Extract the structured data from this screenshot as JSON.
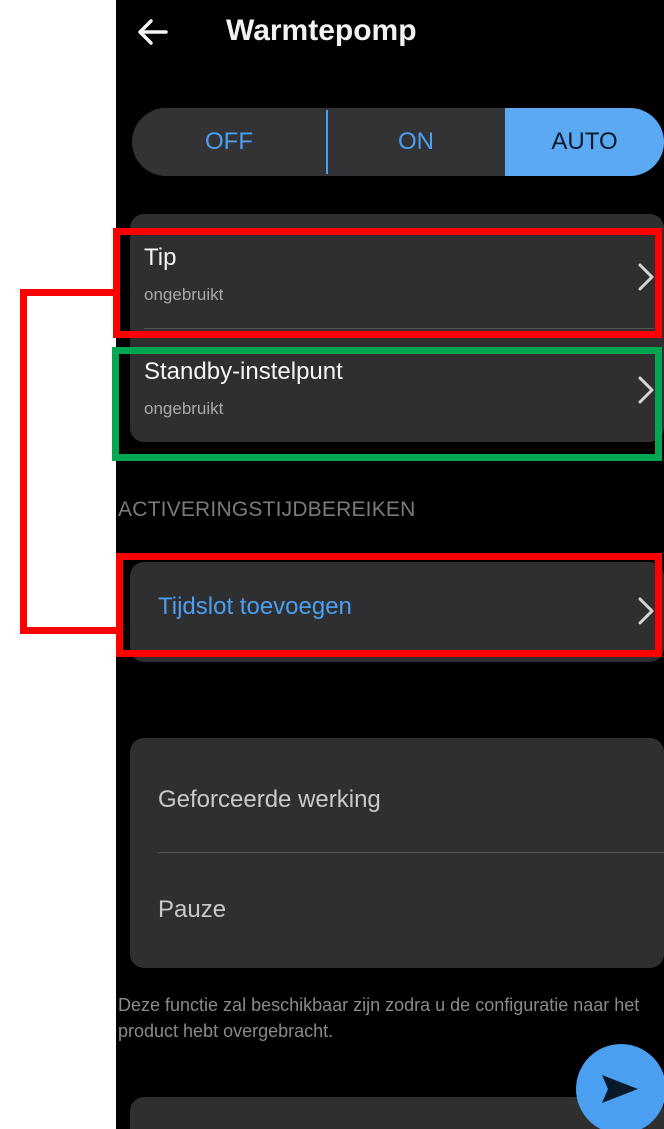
{
  "header": {
    "title": "Warmtepomp"
  },
  "mode": {
    "off": "OFF",
    "on": "ON",
    "auto": "AUTO",
    "selected": "AUTO"
  },
  "settings": [
    {
      "title": "Tip",
      "subtitle": "ongebruikt"
    },
    {
      "title": "Standby-instelpunt",
      "subtitle": "ongebruikt"
    }
  ],
  "activation": {
    "section_title": "ACTIVERINGSTIJDBEREIKEN",
    "add_slot": "Tijdslot toevoegen"
  },
  "actions": {
    "forced": "Geforceerde werking",
    "pause": "Pauze"
  },
  "note": "Deze functie zal beschikbaar zijn zodra u de configuratie naar het product hebt overgebracht.",
  "colors": {
    "accent": "#4a9ff0",
    "annotation_red": "#ff0000",
    "annotation_green": "#00a650"
  },
  "icons": {
    "back": "arrow-left-icon",
    "chevron": "chevron-right-icon",
    "send": "send-icon"
  }
}
